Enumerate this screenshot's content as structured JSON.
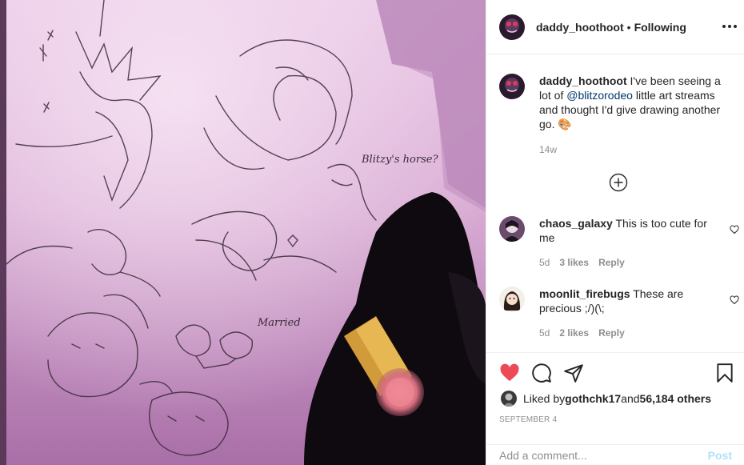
{
  "post": {
    "author": "daddy_hoothoot",
    "separator": "•",
    "follow_status": "Following",
    "more_icon": "more-horizontal-icon",
    "image": {
      "signs": [
        "Blitzy's horse?",
        "Married"
      ]
    }
  },
  "caption": {
    "username": "daddy_hoothoot",
    "text_before": " I've been seeing a lot of ",
    "mention": "@blitzorodeo",
    "text_after": " little art streams and thought I'd give drawing another go. ",
    "emoji": "🎨",
    "time": "14w"
  },
  "load_more_icon": "plus-circle-icon",
  "comments": [
    {
      "username": "chaos_galaxy",
      "text": " This is too cute for me",
      "time": "5d",
      "likes": "3 likes",
      "reply": "Reply"
    },
    {
      "username": "moonlit_firebugs",
      "text": " These are precious ;/)(\\;",
      "time": "5d",
      "likes": "2 likes",
      "reply": "Reply"
    }
  ],
  "actions": {
    "like_icon": "heart-filled-icon",
    "comment_icon": "comment-icon",
    "share_icon": "paper-plane-icon",
    "save_icon": "bookmark-icon",
    "like_color": "#ed4956"
  },
  "liked_by": {
    "prefix": "Liked by ",
    "user": "gothchk17",
    "and": " and ",
    "others": "56,184 others"
  },
  "date": "SEPTEMBER 4",
  "add_comment": {
    "placeholder": "Add a comment...",
    "post_label": "Post"
  }
}
